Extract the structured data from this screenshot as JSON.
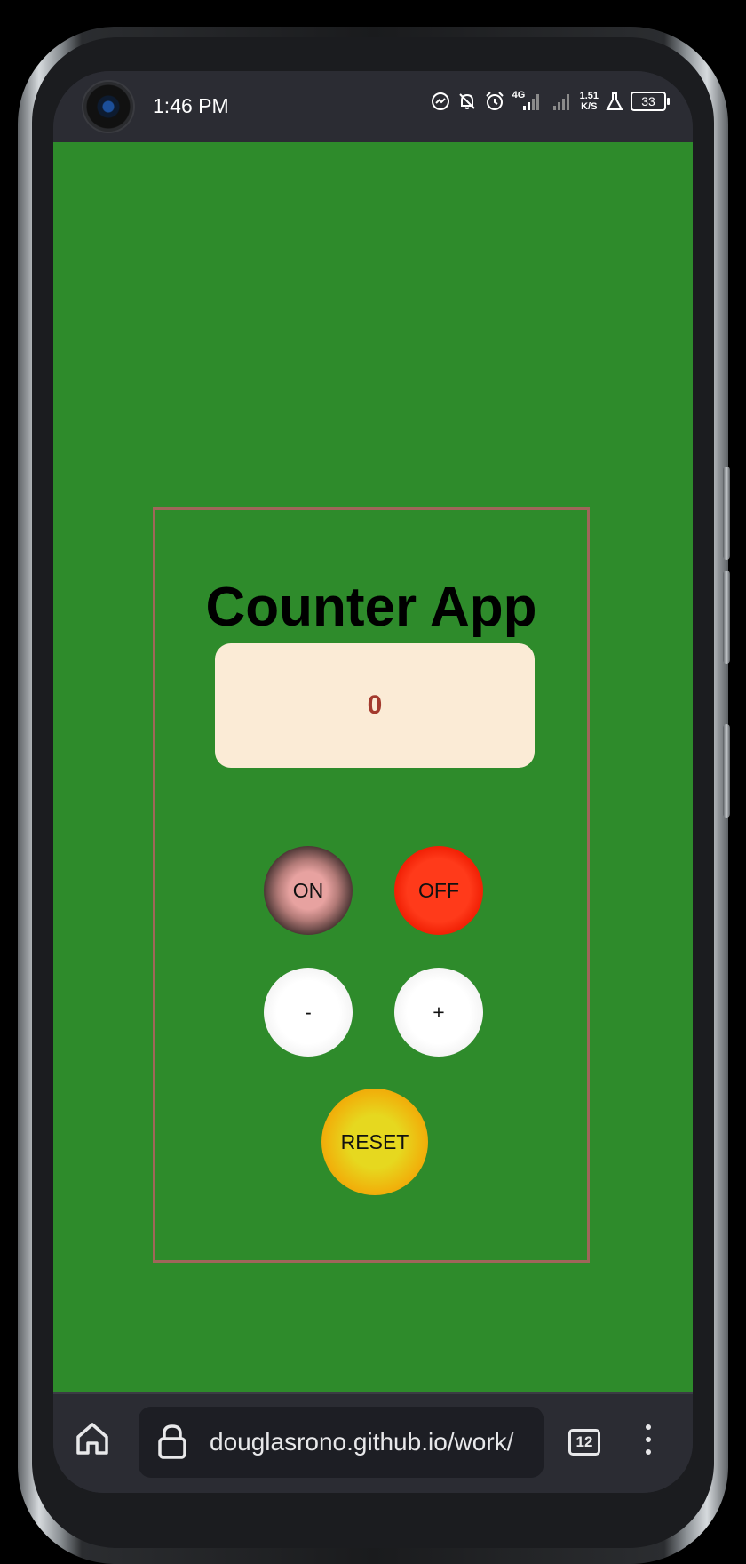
{
  "status_bar": {
    "time": "1:46 PM",
    "network_type": "4G",
    "net_speed_value": "1.51",
    "net_speed_unit": "K/S",
    "battery_level": "33",
    "icons": [
      "messenger-icon",
      "bell-off-icon",
      "alarm-icon",
      "signal-4g-icon",
      "signal-icon",
      "lab-flask-icon",
      "battery-icon"
    ]
  },
  "app": {
    "title": "Counter App",
    "count": "0",
    "buttons": {
      "on": "ON",
      "off": "OFF",
      "decrement": "-",
      "increment": "+",
      "reset": "RESET"
    }
  },
  "browser": {
    "url": "douglasrono.github.io/work/",
    "tab_count": "12"
  },
  "colors": {
    "page_background": "#2e8b2b",
    "card_border": "#a0665a",
    "display_background": "#fbebd6",
    "count_color": "#a33a2e",
    "off_button": "#ff2a10",
    "reset_button": "#f0b30c"
  }
}
